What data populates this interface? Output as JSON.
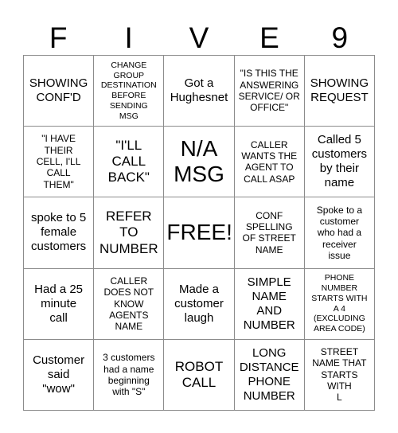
{
  "card": {
    "title_letters": [
      "F",
      "I",
      "V",
      "E",
      "9"
    ],
    "grid": {
      "rows": 5,
      "columns": 5,
      "cells": [
        {
          "text": "SHOWING\nCONF'D",
          "size": "m",
          "marked": false
        },
        {
          "text": "CHANGE\nGROUP\nDESTINATION\nBEFORE\nSENDING\nMSG",
          "size": "xs",
          "marked": false
        },
        {
          "text": "Got a\nHughesnet",
          "size": "m",
          "marked": false
        },
        {
          "text": "\"IS THIS THE\nANSWERING\nSERVICE/ OR\nOFFICE\"",
          "size": "s",
          "marked": false
        },
        {
          "text": "SHOWING\nREQUEST",
          "size": "m",
          "marked": false
        },
        {
          "text": "\"I HAVE\nTHEIR\nCELL, I'LL\nCALL\nTHEM\"",
          "size": "s",
          "marked": false
        },
        {
          "text": "\"I'LL\nCALL\nBACK\"",
          "size": "l",
          "marked": false
        },
        {
          "text": "N/A\nMSG",
          "size": "xl",
          "marked": false
        },
        {
          "text": "CALLER\nWANTS THE\nAGENT TO\nCALL ASAP",
          "size": "s",
          "marked": false
        },
        {
          "text": "Called 5\ncustomers\nby their\nname",
          "size": "m",
          "marked": false
        },
        {
          "text": "spoke to 5\nfemale\ncustomers",
          "size": "m",
          "marked": false
        },
        {
          "text": "REFER\nTO\nNUMBER",
          "size": "l",
          "marked": false
        },
        {
          "text": "FREE!",
          "size": "xl",
          "marked": false
        },
        {
          "text": "CONF\nSPELLING\nOF STREET\nNAME",
          "size": "s",
          "marked": false
        },
        {
          "text": "Spoke to a\ncustomer\nwho had a\nreceiver\nissue",
          "size": "s",
          "marked": false
        },
        {
          "text": "Had a 25\nminute\ncall",
          "size": "m",
          "marked": false
        },
        {
          "text": "CALLER\nDOES NOT\nKNOW\nAGENTS\nNAME",
          "size": "s",
          "marked": false
        },
        {
          "text": "Made a\ncustomer\nlaugh",
          "size": "m",
          "marked": false
        },
        {
          "text": "SIMPLE\nNAME\nAND\nNUMBER",
          "size": "m",
          "marked": false
        },
        {
          "text": "PHONE\nNUMBER\nSTARTS WITH\nA 4\n(EXCLUDING\nAREA CODE)",
          "size": "xs",
          "marked": false
        },
        {
          "text": "Customer\nsaid\n\"wow\"",
          "size": "m",
          "marked": false
        },
        {
          "text": "3 customers\nhad a name\nbeginning\nwith \"S\"",
          "size": "s",
          "marked": false
        },
        {
          "text": "ROBOT\nCALL",
          "size": "l",
          "marked": false
        },
        {
          "text": "LONG\nDISTANCE\nPHONE\nNUMBER",
          "size": "m",
          "marked": false
        },
        {
          "text": "STREET\nNAME THAT\nSTARTS\nWITH\nL",
          "size": "s",
          "marked": false
        }
      ]
    },
    "colors": {
      "background": "#ffffff",
      "text": "#000000",
      "grid_line": "#8c8c8c"
    }
  }
}
